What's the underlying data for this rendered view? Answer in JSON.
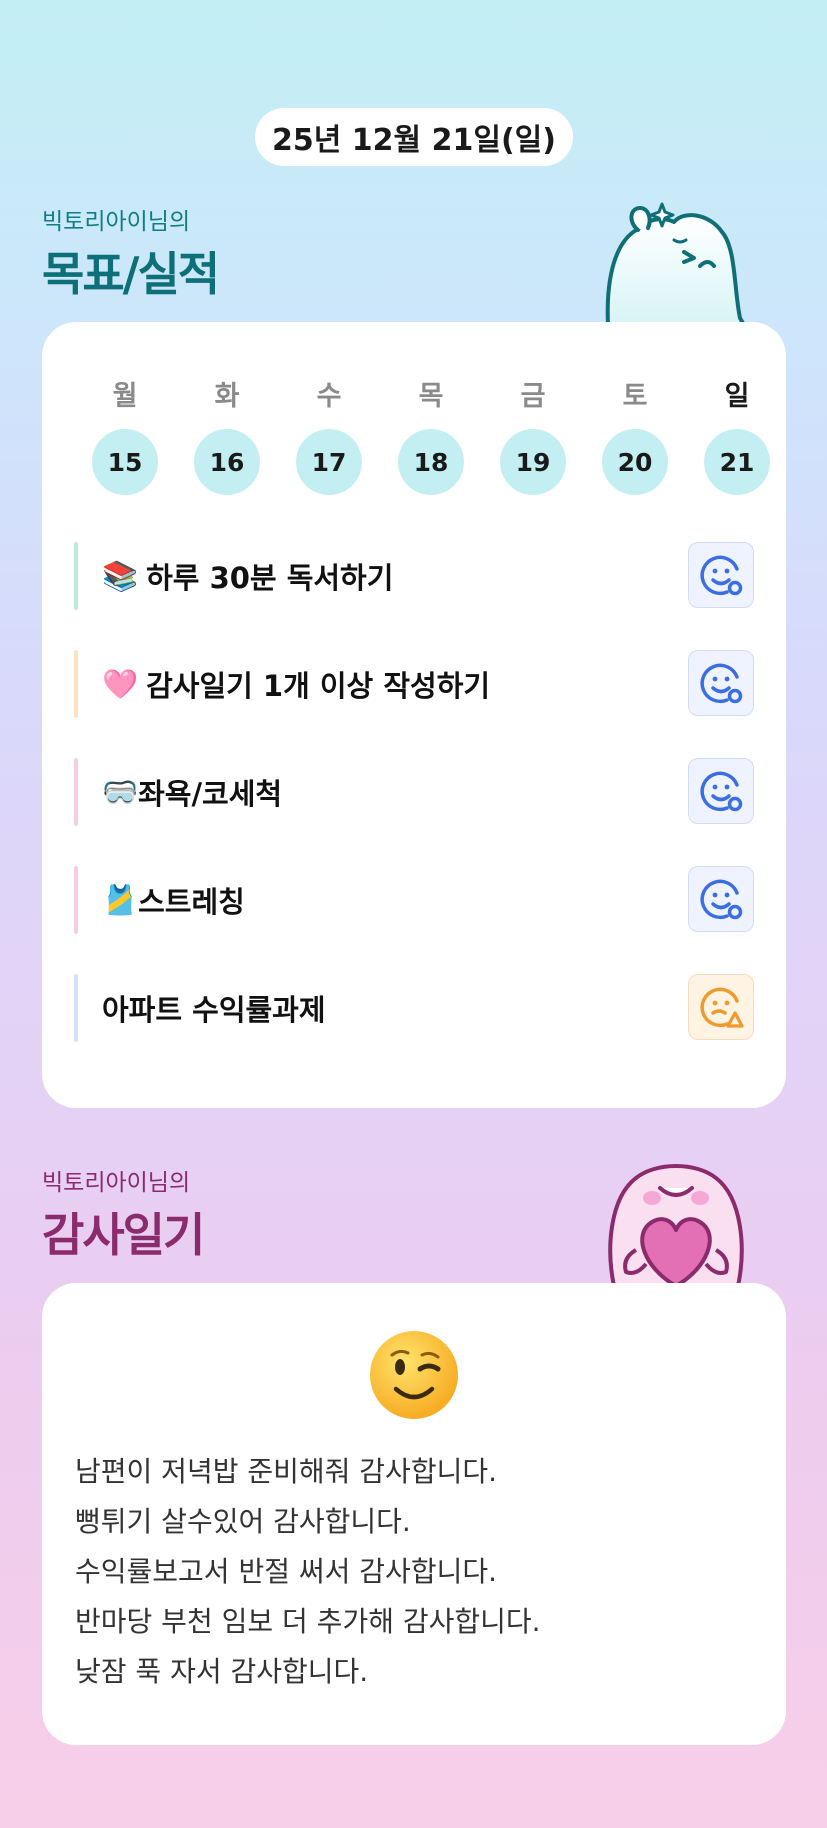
{
  "header": {
    "date": "25년 12월 21일(일)"
  },
  "goals_section": {
    "owner": "빅토리아이님의",
    "title": "목표/실적"
  },
  "week": {
    "weekdays": [
      "월",
      "화",
      "수",
      "목",
      "금",
      "토",
      "일"
    ],
    "days": [
      "15",
      "16",
      "17",
      "18",
      "19",
      "20",
      "21"
    ],
    "selected_index": 6
  },
  "goals": [
    {
      "emoji": "📚",
      "text": "하루 30분 독서하기",
      "bar_color": "#bfeada",
      "status": "face-smile-blue-icon"
    },
    {
      "emoji": "🩷",
      "text": "감사일기 1개 이상 작성하기",
      "bar_color": "#fbe2be",
      "status": "face-smile-blue-icon"
    },
    {
      "emoji": "🥽",
      "text": "좌욕/코세척",
      "bar_color": "#f6cde4",
      "status": "face-smile-blue-icon"
    },
    {
      "emoji": "🎽",
      "text": "스트레칭",
      "bar_color": "#f6cde4",
      "status": "face-smile-blue-icon"
    },
    {
      "emoji": "",
      "text": "아파트 수익률과제",
      "bar_color": "#d6e0f8",
      "status": "face-warning-orange-icon"
    }
  ],
  "diary_section": {
    "owner": "빅토리아이님의",
    "title": "감사일기"
  },
  "diary": {
    "mood_icon": "winking-face-icon",
    "lines": [
      "남편이 저녁밥 준비해줘 감사합니다.",
      "뻥튀기 살수있어 감사합니다.",
      "수익률보고서 반절 써서 감사합니다.",
      "반마당 부천 임보 더 추가해 감사합니다.",
      "낮잠 푹 자서 감사합니다."
    ]
  },
  "colors": {
    "goal_title": "#0d6f78",
    "diary_title": "#8b2a6c",
    "day_circle": "#c4eff2",
    "status_blue": "#3b6ee0",
    "status_orange": "#ef9b2c"
  }
}
